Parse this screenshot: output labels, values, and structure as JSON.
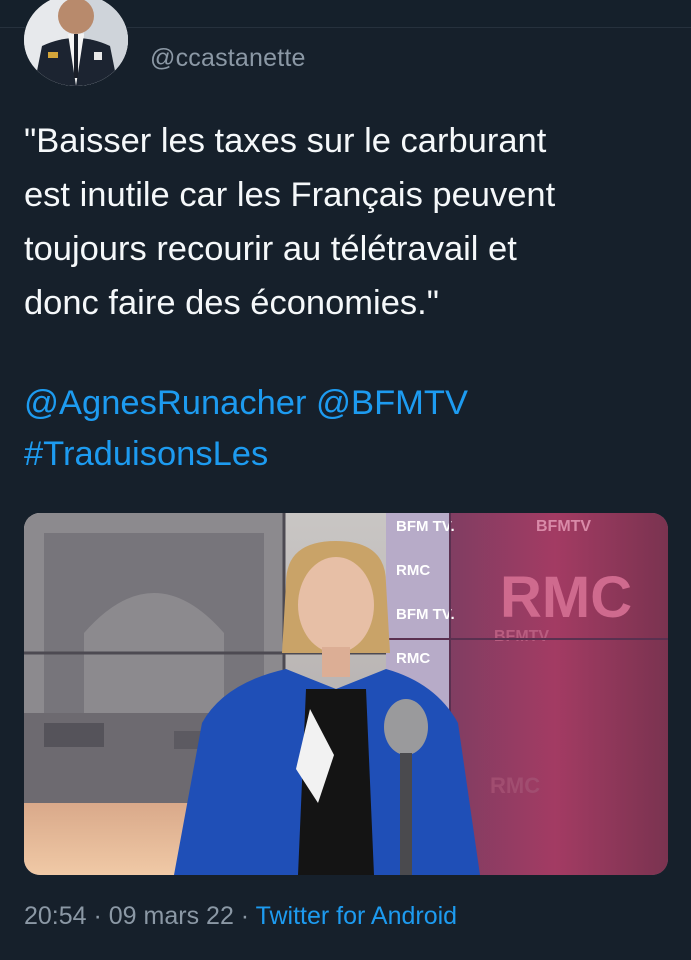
{
  "tweet": {
    "handle": "@ccastanette",
    "text": "\"Baisser les taxes sur le carburant\nest inutile car les Français peuvent\ntoujours recourir au télétravail et\ndonc faire des économies.\"",
    "mentions": [
      {
        "label": "@AgnesRunacher"
      },
      {
        "label": "@BFMTV"
      },
      {
        "label": "#TraduisonsLes"
      }
    ],
    "time": "20:54",
    "date": "09 mars 22",
    "source": "Twitter for Android",
    "separator": " · "
  },
  "media": {
    "screen_labels": [
      "BFM TV.",
      "RMC",
      "BFM TV.",
      "RMC",
      "BFMTV",
      "RMC",
      "BFMTV",
      "RMC"
    ]
  },
  "colors": {
    "background": "#16202b",
    "text": "#f5f8fa",
    "secondary": "#8b98a5",
    "link": "#1d9bf0"
  }
}
